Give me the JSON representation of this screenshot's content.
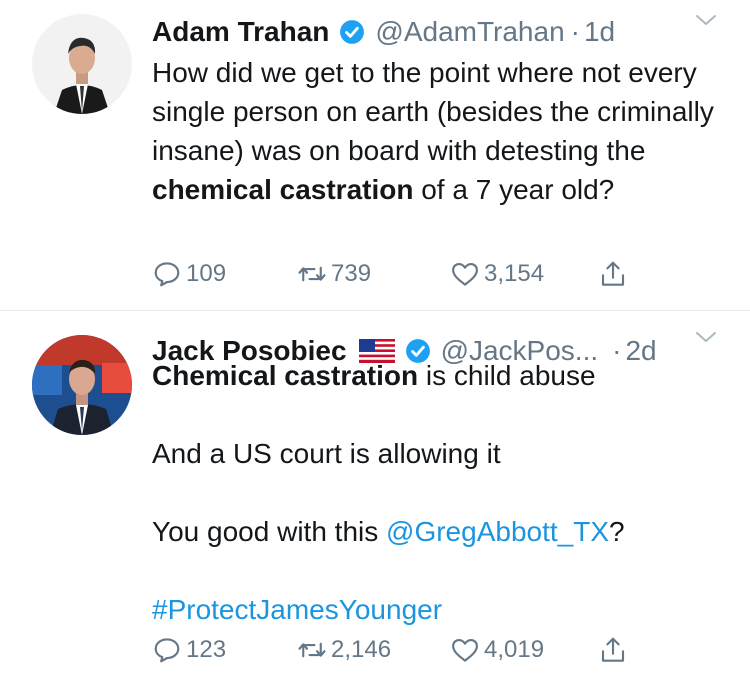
{
  "tweets": [
    {
      "name": "Adam Trahan",
      "handle": "@AdamTrahan",
      "separator": "·",
      "time": "1d",
      "text_parts": [
        "How did we get to the point where not every single person on earth (besides the criminally insane) was on board with detesting the ",
        "chemical castration",
        " of a 7 year old?"
      ],
      "replies": "109",
      "retweets": "739",
      "likes": "3,154",
      "icons": [
        "verified-badge-icon",
        "chevron-down-icon",
        "reply-icon",
        "retweet-icon",
        "heart-icon",
        "share-icon"
      ]
    },
    {
      "name": "Jack Posobiec",
      "handle": "@JackPos...",
      "separator": "·",
      "time": "2d",
      "line1_bold": "Chemical castration",
      "line1_rest": " is child abuse",
      "line2": "And a US court is allowing it",
      "line3_pre": "You good with this ",
      "line3_mention": "@GregAbbott_TX",
      "line3_post": "?",
      "hashtag": "#ProtectJamesYounger",
      "replies": "123",
      "retweets": "2,146",
      "likes": "4,019",
      "icons": [
        "us-flag-icon",
        "verified-badge-icon",
        "chevron-down-icon",
        "reply-icon",
        "retweet-icon",
        "heart-icon",
        "share-icon"
      ]
    }
  ],
  "colors": {
    "text": "#14171a",
    "secondary": "#657786",
    "link": "#1b95e0",
    "verified": "#1da1f2",
    "divider": "#e6ecf0"
  }
}
